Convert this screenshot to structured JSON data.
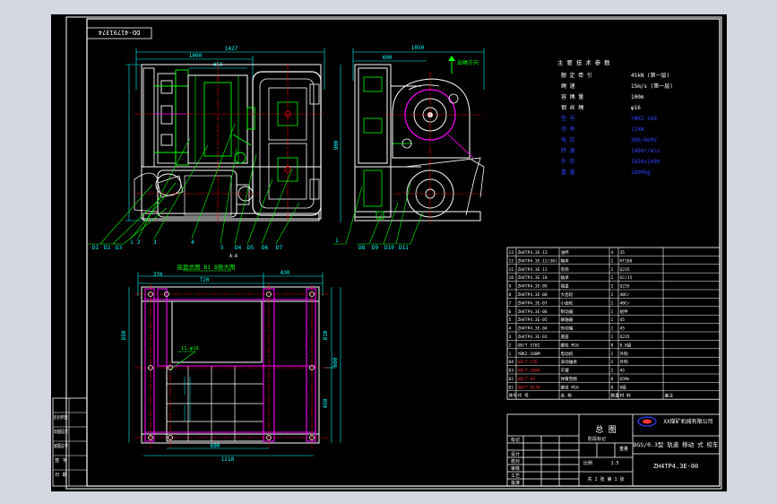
{
  "drawing_number_top": "DD-41791374",
  "drawing_number": "ZH4TP4.3E-00",
  "drawing_title": "总 图",
  "product_name": "DGS/0.3型 轨道 移动 式 绞车",
  "company_name": "XX煤矿机械有限公司",
  "section_label": "底盘总图 B1 B放大图",
  "tech": {
    "heading": "主 要 技 术 参 数",
    "rows": [
      {
        "label": "额 定 牵 引",
        "value": "45kN (第一层)"
      },
      {
        "label": "绳 速",
        "value": "15m/s (第一层)"
      },
      {
        "label": "容 绳 量",
        "value": "100m"
      },
      {
        "label": "钢 丝 绳",
        "value": "φ16"
      },
      {
        "label": "型 号",
        "value": "YBK2-160"
      },
      {
        "label": "功 率",
        "value": "11kW"
      },
      {
        "label": "电 压",
        "value": "380/660V"
      },
      {
        "label": "转 速",
        "value": "1460r/min"
      },
      {
        "label": "外 形",
        "value": "1850x1400"
      },
      {
        "label": "重 量",
        "value": "1800kg"
      }
    ]
  },
  "dims": {
    "top_overall": "1427",
    "top_inner": "1000",
    "top_sub": "450",
    "side_overall": "1050",
    "side_sub": "600",
    "side_height": "900",
    "bottom_left": "720",
    "bottom_right": "430",
    "bottom_total": "1210",
    "bottom_inner": "600",
    "right_height": "810",
    "right_sub": "600",
    "right_lower": "450",
    "base_width": "370",
    "base_height": "850",
    "hole_note": "11-φ16",
    "arrow_label": "出绳方向",
    "section_mark": "A-A"
  },
  "leaders": {
    "front": [
      "D1",
      "D2",
      "D3",
      "1",
      "2",
      "3",
      "4",
      "5",
      "D4",
      "D5",
      "D6",
      "D7"
    ],
    "side": [
      "1",
      "D8",
      "D9",
      "D10",
      "D11"
    ]
  },
  "bom_rows": [
    {
      "no": "13",
      "code": "ZH4TP4.3E-13",
      "name": "油杯",
      "qty": "4",
      "mat": "35",
      "note": ""
    },
    {
      "no": "12",
      "code": "ZH4TP4.3E-12(30)",
      "name": "箱体",
      "qty": "1",
      "mat": "HT200",
      "note": ""
    },
    {
      "no": "11",
      "code": "ZH4TP4.3E-11",
      "name": "卷筒",
      "qty": "1",
      "mat": "Q235",
      "note": ""
    },
    {
      "no": "10",
      "code": "ZH4TP4.3E-10",
      "name": "轴承",
      "qty": "2",
      "mat": "GCr15",
      "note": ""
    },
    {
      "no": "9",
      "code": "ZH4TP4.3E-09",
      "name": "端盖",
      "qty": "2",
      "mat": "Q235",
      "note": ""
    },
    {
      "no": "8",
      "code": "ZH4TP4.3E-08",
      "name": "大齿轮",
      "qty": "1",
      "mat": "40Cr",
      "note": ""
    },
    {
      "no": "7",
      "code": "ZH4TP4.3E-07",
      "name": "小齿轮",
      "qty": "1",
      "mat": "40Cr",
      "note": ""
    },
    {
      "no": "6",
      "code": "ZH4TP4.3E-06",
      "name": "制动器",
      "qty": "1",
      "mat": "组件",
      "note": ""
    },
    {
      "no": "5",
      "code": "ZH4TP4.3E-05",
      "name": "联轴器",
      "qty": "1",
      "mat": "45",
      "note": ""
    },
    {
      "no": "4",
      "code": "ZH4TP4.3E-04",
      "name": "传动轴",
      "qty": "1",
      "mat": "45",
      "note": ""
    },
    {
      "no": "3",
      "code": "ZH4TP4.3E-03",
      "name": "底座",
      "qty": "1",
      "mat": "Q235",
      "note": ""
    },
    {
      "no": "2",
      "code": "GB/T 5782",
      "name": "螺栓 M16",
      "qty": "8",
      "mat": "8.8级",
      "note": ""
    },
    {
      "no": "1",
      "code": "YBK2-160M",
      "name": "电动机",
      "qty": "1",
      "mat": "外购",
      "note": ""
    },
    {
      "no": "D4",
      "code": "GB/T 276",
      "name": "滚动轴承",
      "qty": "2",
      "mat": "外购",
      "note": ""
    },
    {
      "no": "D3",
      "code": "GB/T 1096",
      "name": "平键",
      "qty": "2",
      "mat": "45",
      "note": ""
    },
    {
      "no": "D2",
      "code": "GB/T 93",
      "name": "弹簧垫圈",
      "qty": "8",
      "mat": "65Mn",
      "note": ""
    },
    {
      "no": "D1",
      "code": "GB/T 6170",
      "name": "螺母 M16",
      "qty": "8",
      "mat": "8级",
      "note": ""
    }
  ],
  "bom_header": [
    "序号",
    "代 号",
    "名 称",
    "数量",
    "材 料",
    "备注"
  ],
  "title_labels": {
    "mark": "标记",
    "design": "设计",
    "check": "校对",
    "review": "审核",
    "process": "工艺",
    "approve": "批准",
    "stage": "阶段标记",
    "weight": "重量",
    "scale": "比例",
    "scale_value": "1:5",
    "sheet": "共 1 张 第 1 张"
  },
  "left_strip": [
    "借(通)用件登记",
    "旧底图总号",
    "底图总号",
    "签 字",
    "日 期"
  ],
  "colors": {
    "background": "#000000",
    "outline": "#ffffff",
    "part": "#00ff00",
    "center": "#ff0000",
    "dimension": "#00ffff",
    "highlight": "#ff00ff",
    "text_blue": "#3344ff",
    "bom_red": "#ff3333",
    "frame_bg": "#d3d7e0"
  }
}
